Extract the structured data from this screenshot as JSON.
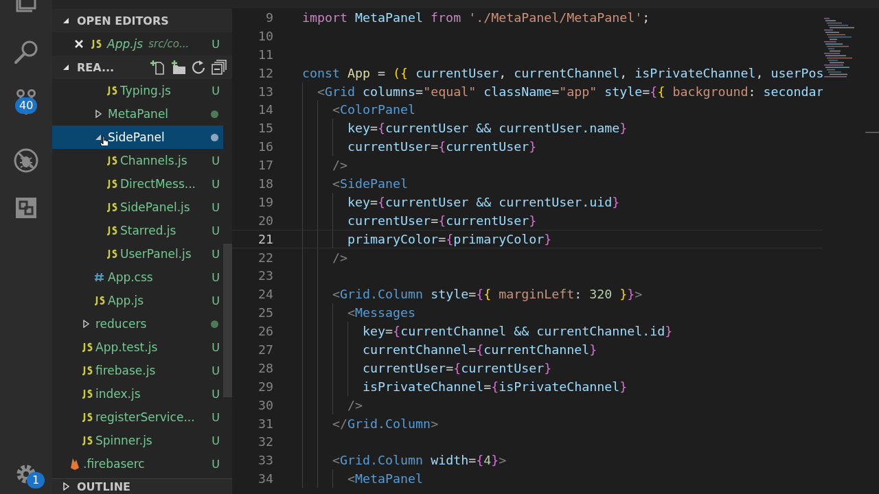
{
  "activity_bar": {
    "badges": [
      {
        "kind": "source-control",
        "text": "40"
      },
      {
        "kind": "settings",
        "text": "1"
      }
    ]
  },
  "explorer": {
    "sections": [
      {
        "kind": "open-editors",
        "title": "OPEN EDITORS",
        "expanded": true,
        "items": [
          {
            "name": "App.js",
            "description": "src/co...",
            "badge": "U"
          }
        ]
      },
      {
        "kind": "folder",
        "title": "REA...",
        "expanded": true,
        "tree": [
          {
            "children": [
              {
                "children": [
                  {
                    "children": [
                      {
                        "kind": "js-file",
                        "name": "Typing.js",
                        "badge": "U",
                        "selected": false
                      }
                    ]
                  },
                  {
                    "kind": "folder",
                    "name": "MetaPanel",
                    "expanded": false,
                    "color": "#4e7a57",
                    "selected": false
                  },
                  {
                    "kind": "folder",
                    "name": "SidePanel",
                    "expanded": true,
                    "color": "#8fa5bd",
                    "selected": true,
                    "children": [
                      {
                        "kind": "js-file",
                        "name": "Channels.js",
                        "badge": "U",
                        "selected": false
                      },
                      {
                        "kind": "js-file",
                        "name": "DirectMess...",
                        "badge": "U",
                        "selected": false
                      },
                      {
                        "kind": "js-file",
                        "name": "SidePanel.js",
                        "badge": "U",
                        "selected": false
                      },
                      {
                        "kind": "js-file",
                        "name": "Starred.js",
                        "badge": "U",
                        "selected": false
                      },
                      {
                        "kind": "js-file",
                        "name": "UserPanel.js",
                        "badge": "U",
                        "selected": false
                      }
                    ]
                  },
                  {
                    "kind": "css-file",
                    "name": "App.css",
                    "badge": "U",
                    "selected": false
                  },
                  {
                    "kind": "js-file",
                    "name": "App.js",
                    "badge": "U",
                    "selected": false
                  }
                ]
              },
              {
                "kind": "folder",
                "name": "reducers",
                "expanded": false,
                "color": "#4e7a57",
                "selected": false
              },
              {
                "kind": "js-file",
                "name": "App.test.js",
                "badge": "U",
                "selected": false
              },
              {
                "kind": "js-file",
                "name": "firebase.js",
                "badge": "U",
                "selected": false
              },
              {
                "kind": "js-file",
                "name": "index.js",
                "badge": "U",
                "selected": false
              },
              {
                "kind": "js-file",
                "name": "registerService...",
                "badge": "U",
                "selected": false
              },
              {
                "kind": "js-file",
                "name": "Spinner.js",
                "badge": "U",
                "selected": false
              }
            ]
          },
          {
            "kind": "firebase-file",
            "name": ".firebaserc",
            "badge": "U",
            "selected": false
          }
        ]
      },
      {
        "kind": "outline",
        "title": "OUTLINE",
        "expanded": false
      }
    ]
  },
  "editor": {
    "lines": [
      {
        "number": "9",
        "current": false,
        "tokens": [
          {
            "kind": "kw",
            "text": "import "
          },
          {
            "kind": "var",
            "text": "MetaPanel "
          },
          {
            "kind": "kw",
            "text": "from "
          },
          {
            "kind": "str",
            "text": "'./MetaPanel/MetaPanel'"
          },
          {
            "kind": "plain",
            "text": ";"
          }
        ]
      },
      {
        "number": "10",
        "current": false
      },
      {
        "number": "11",
        "current": false
      },
      {
        "number": "12",
        "current": false,
        "tokens": [
          {
            "kind": "decl",
            "text": "const "
          },
          {
            "kind": "fn",
            "text": "App"
          },
          {
            "kind": "plain",
            "text": " = "
          },
          {
            "kind": "brace",
            "text": "({ "
          },
          {
            "kind": "var",
            "text": "currentUser"
          },
          {
            "kind": "plain",
            "text": ", "
          },
          {
            "kind": "var",
            "text": "currentChannel"
          },
          {
            "kind": "plain",
            "text": ", "
          },
          {
            "kind": "var",
            "text": "isPrivateChannel"
          },
          {
            "kind": "plain",
            "text": ", "
          },
          {
            "kind": "var",
            "text": "userPos"
          }
        ]
      },
      {
        "number": "13",
        "current": false,
        "tokens": [
          {
            "kind": "tag",
            "text": "  <"
          },
          {
            "kind": "comp",
            "text": "Grid "
          },
          {
            "kind": "var",
            "text": "columns"
          },
          {
            "kind": "plain",
            "text": "="
          },
          {
            "kind": "str",
            "text": "\"equal\" "
          },
          {
            "kind": "var",
            "text": "className"
          },
          {
            "kind": "plain",
            "text": "="
          },
          {
            "kind": "str",
            "text": "\"app\" "
          },
          {
            "kind": "var",
            "text": "style"
          },
          {
            "kind": "plain",
            "text": "="
          },
          {
            "kind": "jsx",
            "text": "{"
          },
          {
            "kind": "brace",
            "text": "{ "
          },
          {
            "kind": "prop",
            "text": "background"
          },
          {
            "kind": "plain",
            "text": ": "
          },
          {
            "kind": "var",
            "text": "secondar"
          }
        ]
      },
      {
        "number": "14",
        "current": false,
        "tokens": [
          {
            "kind": "tag",
            "text": "    <"
          },
          {
            "kind": "comp",
            "text": "ColorPanel"
          }
        ]
      },
      {
        "number": "15",
        "current": false,
        "tokens": [
          {
            "kind": "var",
            "text": "      key"
          },
          {
            "kind": "plain",
            "text": "="
          },
          {
            "kind": "jsx",
            "text": "{"
          },
          {
            "kind": "var",
            "text": "currentUser && currentUser.name"
          },
          {
            "kind": "jsx",
            "text": "}"
          }
        ]
      },
      {
        "number": "16",
        "current": false,
        "tokens": [
          {
            "kind": "var",
            "text": "      currentUser"
          },
          {
            "kind": "plain",
            "text": "="
          },
          {
            "kind": "jsx",
            "text": "{"
          },
          {
            "kind": "var",
            "text": "currentUser"
          },
          {
            "kind": "jsx",
            "text": "}"
          }
        ]
      },
      {
        "number": "17",
        "current": false,
        "tokens": [
          {
            "kind": "tag",
            "text": "    />"
          }
        ]
      },
      {
        "number": "18",
        "current": false,
        "tokens": [
          {
            "kind": "tag",
            "text": "    <"
          },
          {
            "kind": "comp",
            "text": "SidePanel"
          }
        ]
      },
      {
        "number": "19",
        "current": false,
        "tokens": [
          {
            "kind": "var",
            "text": "      key"
          },
          {
            "kind": "plain",
            "text": "="
          },
          {
            "kind": "jsx",
            "text": "{"
          },
          {
            "kind": "var",
            "text": "currentUser && currentUser.uid"
          },
          {
            "kind": "jsx",
            "text": "}"
          }
        ]
      },
      {
        "number": "20",
        "current": false,
        "tokens": [
          {
            "kind": "var",
            "text": "      currentUser"
          },
          {
            "kind": "plain",
            "text": "="
          },
          {
            "kind": "jsx",
            "text": "{"
          },
          {
            "kind": "var",
            "text": "currentUser"
          },
          {
            "kind": "jsx",
            "text": "}"
          }
        ]
      },
      {
        "number": "21",
        "current": true,
        "tokens": [
          {
            "kind": "var",
            "text": "      primaryColor"
          },
          {
            "kind": "plain",
            "text": "="
          },
          {
            "kind": "jsx",
            "text": "{"
          },
          {
            "kind": "var",
            "text": "primaryColor"
          },
          {
            "kind": "jsx",
            "text": "}"
          }
        ]
      },
      {
        "number": "22",
        "current": false,
        "tokens": [
          {
            "kind": "tag",
            "text": "    />"
          }
        ]
      },
      {
        "number": "23",
        "current": false
      },
      {
        "number": "24",
        "current": false,
        "tokens": [
          {
            "kind": "tag",
            "text": "    <"
          },
          {
            "kind": "comp",
            "text": "Grid.Column "
          },
          {
            "kind": "var",
            "text": "style"
          },
          {
            "kind": "plain",
            "text": "="
          },
          {
            "kind": "jsx",
            "text": "{"
          },
          {
            "kind": "brace",
            "text": "{ "
          },
          {
            "kind": "prop",
            "text": "marginLeft"
          },
          {
            "kind": "plain",
            "text": ": "
          },
          {
            "kind": "num",
            "text": "320 "
          },
          {
            "kind": "brace",
            "text": "}"
          },
          {
            "kind": "jsx",
            "text": "}"
          },
          {
            "kind": "tag",
            "text": ">"
          }
        ]
      },
      {
        "number": "25",
        "current": false,
        "tokens": [
          {
            "kind": "tag",
            "text": "      <"
          },
          {
            "kind": "comp",
            "text": "Messages"
          }
        ]
      },
      {
        "number": "26",
        "current": false,
        "tokens": [
          {
            "kind": "var",
            "text": "        key"
          },
          {
            "kind": "plain",
            "text": "="
          },
          {
            "kind": "jsx",
            "text": "{"
          },
          {
            "kind": "var",
            "text": "currentChannel && currentChannel.id"
          },
          {
            "kind": "jsx",
            "text": "}"
          }
        ]
      },
      {
        "number": "27",
        "current": false,
        "tokens": [
          {
            "kind": "var",
            "text": "        currentChannel"
          },
          {
            "kind": "plain",
            "text": "="
          },
          {
            "kind": "jsx",
            "text": "{"
          },
          {
            "kind": "var",
            "text": "currentChannel"
          },
          {
            "kind": "jsx",
            "text": "}"
          }
        ]
      },
      {
        "number": "28",
        "current": false,
        "tokens": [
          {
            "kind": "var",
            "text": "        currentUser"
          },
          {
            "kind": "plain",
            "text": "="
          },
          {
            "kind": "jsx",
            "text": "{"
          },
          {
            "kind": "var",
            "text": "currentUser"
          },
          {
            "kind": "jsx",
            "text": "}"
          }
        ]
      },
      {
        "number": "29",
        "current": false,
        "tokens": [
          {
            "kind": "var",
            "text": "        isPrivateChannel"
          },
          {
            "kind": "plain",
            "text": "="
          },
          {
            "kind": "jsx",
            "text": "{"
          },
          {
            "kind": "var",
            "text": "isPrivateChannel"
          },
          {
            "kind": "jsx",
            "text": "}"
          }
        ]
      },
      {
        "number": "30",
        "current": false,
        "tokens": [
          {
            "kind": "tag",
            "text": "      />"
          }
        ]
      },
      {
        "number": "31",
        "current": false,
        "tokens": [
          {
            "kind": "tag",
            "text": "    </"
          },
          {
            "kind": "comp",
            "text": "Grid.Column"
          },
          {
            "kind": "tag",
            "text": ">"
          }
        ]
      },
      {
        "number": "32",
        "current": false
      },
      {
        "number": "33",
        "current": false,
        "tokens": [
          {
            "kind": "tag",
            "text": "    <"
          },
          {
            "kind": "comp",
            "text": "Grid.Column "
          },
          {
            "kind": "var",
            "text": "width"
          },
          {
            "kind": "plain",
            "text": "="
          },
          {
            "kind": "jsx",
            "text": "{"
          },
          {
            "kind": "num",
            "text": "4"
          },
          {
            "kind": "jsx",
            "text": "}"
          },
          {
            "kind": "tag",
            "text": ">"
          }
        ]
      },
      {
        "number": "34",
        "current": false,
        "tokens": [
          {
            "kind": "tag",
            "text": "      <"
          },
          {
            "kind": "comp",
            "text": "MetaPanel"
          }
        ]
      }
    ]
  }
}
